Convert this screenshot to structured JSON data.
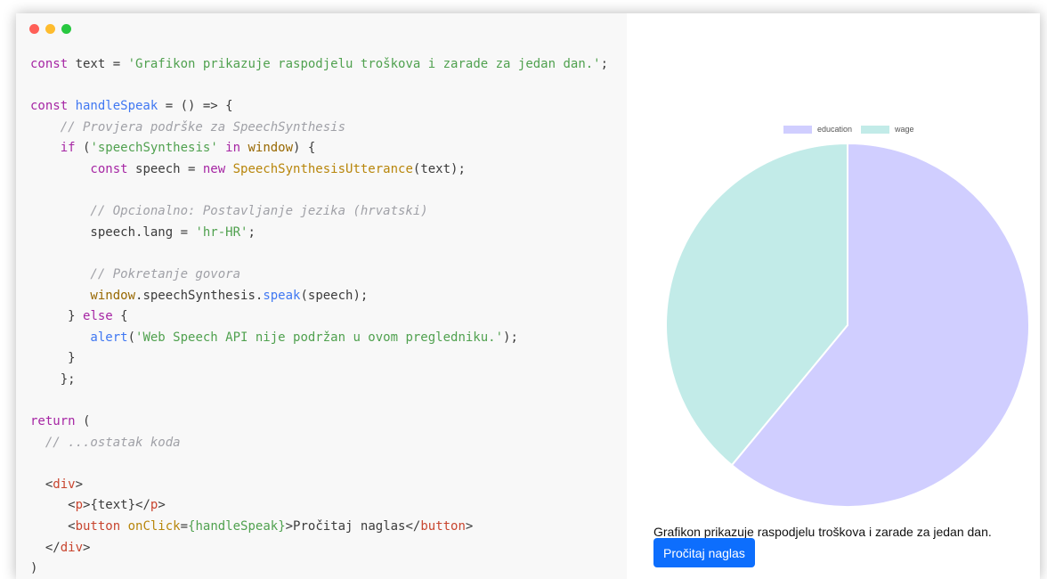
{
  "window": {
    "controls": [
      {
        "name": "close",
        "color": "#ff5f57"
      },
      {
        "name": "minimize",
        "color": "#febc2e"
      },
      {
        "name": "maximize",
        "color": "#28c840"
      }
    ]
  },
  "code": {
    "lines": [
      [
        {
          "c": "k",
          "t": "const "
        },
        {
          "c": "p",
          "t": "text = "
        },
        {
          "c": "s",
          "t": "'Grafikon prikazuje raspodjelu troškova i zarade za jedan dan.'"
        },
        {
          "c": "p",
          "t": ";"
        }
      ],
      [],
      [
        {
          "c": "k",
          "t": "const "
        },
        {
          "c": "fn",
          "t": "handleSpeak"
        },
        {
          "c": "p",
          "t": " = () => {"
        }
      ],
      [
        {
          "c": "c",
          "t": "    // Provjera podrške za SpeechSynthesis"
        }
      ],
      [
        {
          "c": "k",
          "t": "    if "
        },
        {
          "c": "p",
          "t": "("
        },
        {
          "c": "s",
          "t": "'speechSynthesis'"
        },
        {
          "c": "k",
          "t": " in "
        },
        {
          "c": "g",
          "t": "window"
        },
        {
          "c": "p",
          "t": ") {"
        }
      ],
      [
        {
          "c": "k",
          "t": "        const "
        },
        {
          "c": "p",
          "t": "speech = "
        },
        {
          "c": "k",
          "t": "new "
        },
        {
          "c": "a",
          "t": "SpeechSynthesisUtterance"
        },
        {
          "c": "p",
          "t": "(text);"
        }
      ],
      [],
      [
        {
          "c": "c",
          "t": "        // Opcionalno: Postavljanje jezika (hrvatski)"
        }
      ],
      [
        {
          "c": "p",
          "t": "        speech.lang = "
        },
        {
          "c": "s",
          "t": "'hr-HR'"
        },
        {
          "c": "p",
          "t": ";"
        }
      ],
      [],
      [
        {
          "c": "c",
          "t": "        // Pokretanje govora"
        }
      ],
      [
        {
          "c": "g",
          "t": "        window"
        },
        {
          "c": "p",
          "t": ".speechSynthesis."
        },
        {
          "c": "fn",
          "t": "speak"
        },
        {
          "c": "p",
          "t": "(speech);"
        }
      ],
      [
        {
          "c": "p",
          "t": "     } "
        },
        {
          "c": "k",
          "t": "else"
        },
        {
          "c": "p",
          "t": " {"
        }
      ],
      [
        {
          "c": "fn",
          "t": "        alert"
        },
        {
          "c": "p",
          "t": "("
        },
        {
          "c": "s",
          "t": "'Web Speech API nije podržan u ovom pregledniku.'"
        },
        {
          "c": "p",
          "t": ");"
        }
      ],
      [
        {
          "c": "p",
          "t": "     }"
        }
      ],
      [
        {
          "c": "p",
          "t": "    };"
        }
      ],
      [],
      [
        {
          "c": "k",
          "t": "return"
        },
        {
          "c": "p",
          "t": " ("
        }
      ],
      [
        {
          "c": "c",
          "t": "  // ...ostatak koda"
        }
      ],
      [],
      [
        {
          "c": "p",
          "t": "  <"
        },
        {
          "c": "t",
          "t": "div"
        },
        {
          "c": "p",
          "t": ">"
        }
      ],
      [
        {
          "c": "p",
          "t": "     <"
        },
        {
          "c": "t",
          "t": "p"
        },
        {
          "c": "p",
          "t": ">{text}</"
        },
        {
          "c": "t",
          "t": "p"
        },
        {
          "c": "p",
          "t": ">"
        }
      ],
      [
        {
          "c": "p",
          "t": "     <"
        },
        {
          "c": "t",
          "t": "button"
        },
        {
          "c": "p",
          "t": " "
        },
        {
          "c": "a",
          "t": "onClick"
        },
        {
          "c": "p",
          "t": "="
        },
        {
          "c": "s",
          "t": "{handleSpeak}"
        },
        {
          "c": "p",
          "t": ">Pročitaj naglas</"
        },
        {
          "c": "t",
          "t": "button"
        },
        {
          "c": "p",
          "t": ">"
        }
      ],
      [
        {
          "c": "p",
          "t": "  </"
        },
        {
          "c": "t",
          "t": "div"
        },
        {
          "c": "p",
          "t": ">"
        }
      ],
      [
        {
          "c": "p",
          "t": ")"
        }
      ]
    ]
  },
  "preview": {
    "chart_data": {
      "type": "pie",
      "categories": [
        "education",
        "wage"
      ],
      "values": [
        61,
        39
      ],
      "colors": [
        "#d0ceff",
        "#c2ebe8"
      ],
      "legend": "top"
    },
    "caption": "Grafikon prikazuje raspodjelu troškova i zarade za jedan dan.",
    "button_label": "Pročitaj naglas"
  }
}
